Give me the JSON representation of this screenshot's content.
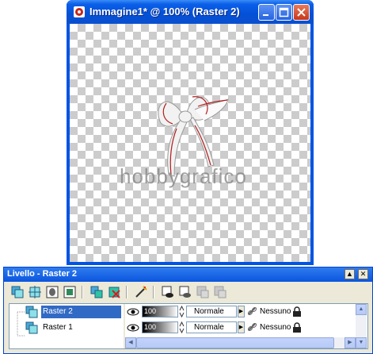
{
  "image_window": {
    "title": "Immagine1* @ 100% (Raster 2)",
    "watermark": "hobbygrafico"
  },
  "layer_palette": {
    "title": "Livello - Raster 2",
    "layers": [
      {
        "name": "Raster 2",
        "opacity": "100",
        "blend_mode": "Normale",
        "link": "Nessuno",
        "selected": true
      },
      {
        "name": "Raster 1",
        "opacity": "100",
        "blend_mode": "Normale",
        "link": "Nessuno",
        "selected": false
      }
    ]
  }
}
